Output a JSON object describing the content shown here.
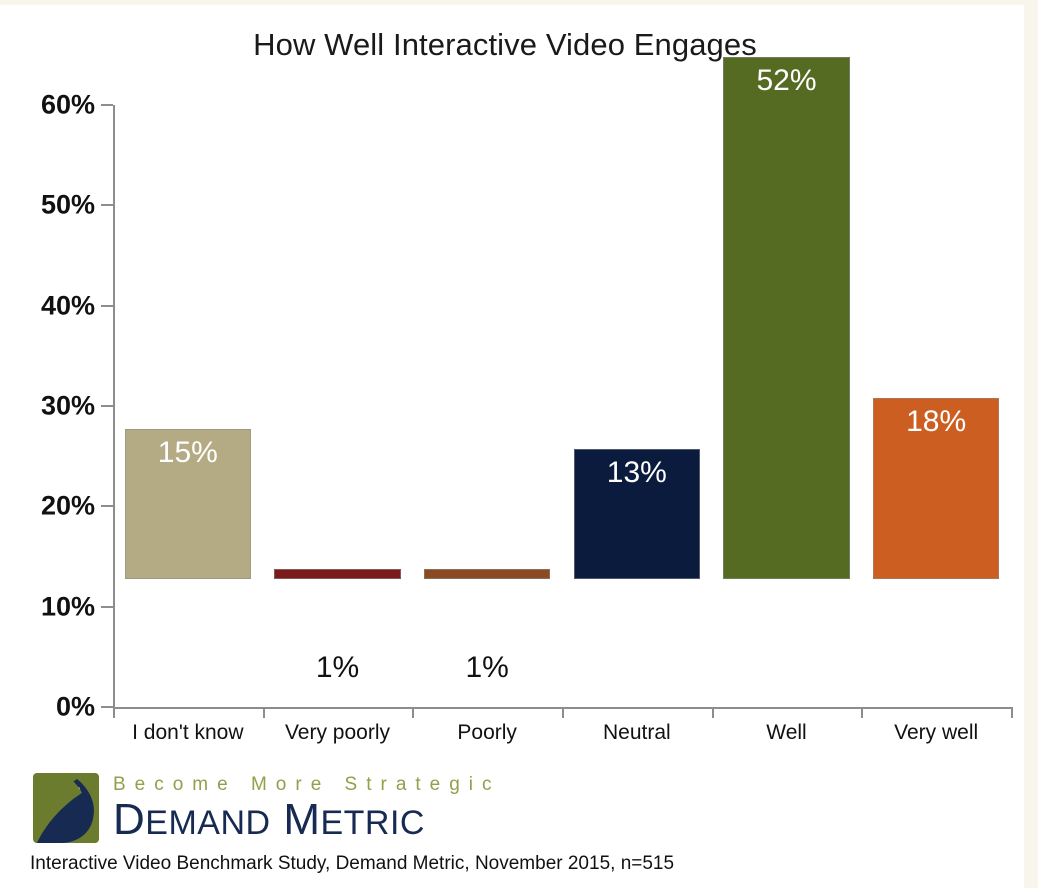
{
  "chart_data": {
    "type": "bar",
    "title": "How Well Interactive Video Engages",
    "xlabel": "",
    "ylabel": "",
    "categories": [
      "I don't know",
      "Very poorly",
      "Poorly",
      "Neutral",
      "Well",
      "Very well"
    ],
    "values": [
      15,
      1,
      1,
      13,
      52,
      18
    ],
    "value_labels": [
      "15%",
      "1%",
      "1%",
      "13%",
      "52%",
      "18%"
    ],
    "label_placement": [
      "inside",
      "above",
      "above",
      "inside",
      "inside",
      "inside"
    ],
    "bar_colors": [
      "#b4ab85",
      "#7b1a1a",
      "#8c4a22",
      "#0a1b3d",
      "#556b22",
      "#cd5e22"
    ],
    "ylim": [
      0,
      60
    ],
    "yticks": [
      0,
      10,
      20,
      30,
      40,
      50,
      60
    ],
    "ytick_labels": [
      "0%",
      "10%",
      "20%",
      "30%",
      "40%",
      "50%",
      "60%"
    ],
    "grid": false,
    "legend": false
  },
  "footer": {
    "source_note": "Interactive Video Benchmark Study, Demand Metric, November 2015, n=515"
  },
  "logo": {
    "tagline": "Become More Strategic",
    "name_part1_cap": "D",
    "name_part1_rest": "EMAND",
    "name_part2_cap": "M",
    "name_part2_rest": "ETRIC",
    "mark_green": "#6c7c2e",
    "mark_navy": "#172a52",
    "tagline_color": "#8fa14a",
    "name_color": "#172a52"
  },
  "colors": {
    "axis": "#8d8d8d",
    "text": "#111111",
    "background": "#ffffff",
    "page_border": "#f7f5ec"
  }
}
